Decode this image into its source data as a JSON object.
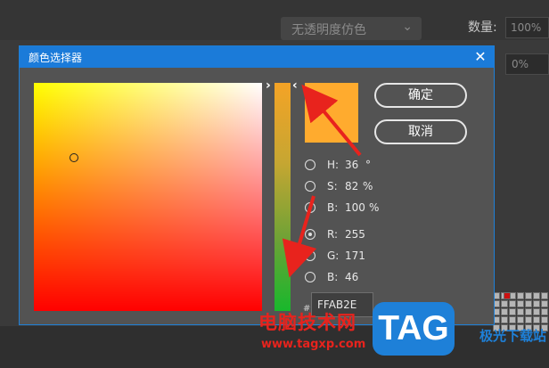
{
  "background": {
    "dropdown_label": "无透明度仿色",
    "count_label": "数量:",
    "count_value": "100%",
    "second_value": "0%"
  },
  "dialog": {
    "title": "颜色选择器",
    "ok_label": "确定",
    "cancel_label": "取消",
    "selected_color": "#ffab2e",
    "fields": [
      {
        "label": "H:",
        "value": "36",
        "unit": "°",
        "checked": false
      },
      {
        "label": "S:",
        "value": "82",
        "unit": "%",
        "checked": false
      },
      {
        "label": "B:",
        "value": "100",
        "unit": "%",
        "checked": false
      },
      {
        "label": "R:",
        "value": "255",
        "unit": "",
        "checked": true
      },
      {
        "label": "G:",
        "value": "171",
        "unit": "",
        "checked": false
      },
      {
        "label": "B:",
        "value": "46",
        "unit": "",
        "checked": false
      }
    ],
    "hex_prefix": "#",
    "hex_value": "FFAB2E"
  },
  "watermark": {
    "site_name": "电脑技术网",
    "url": "www.tagxp.com",
    "logo_text": "TAG",
    "side_text": "极光下载站"
  }
}
